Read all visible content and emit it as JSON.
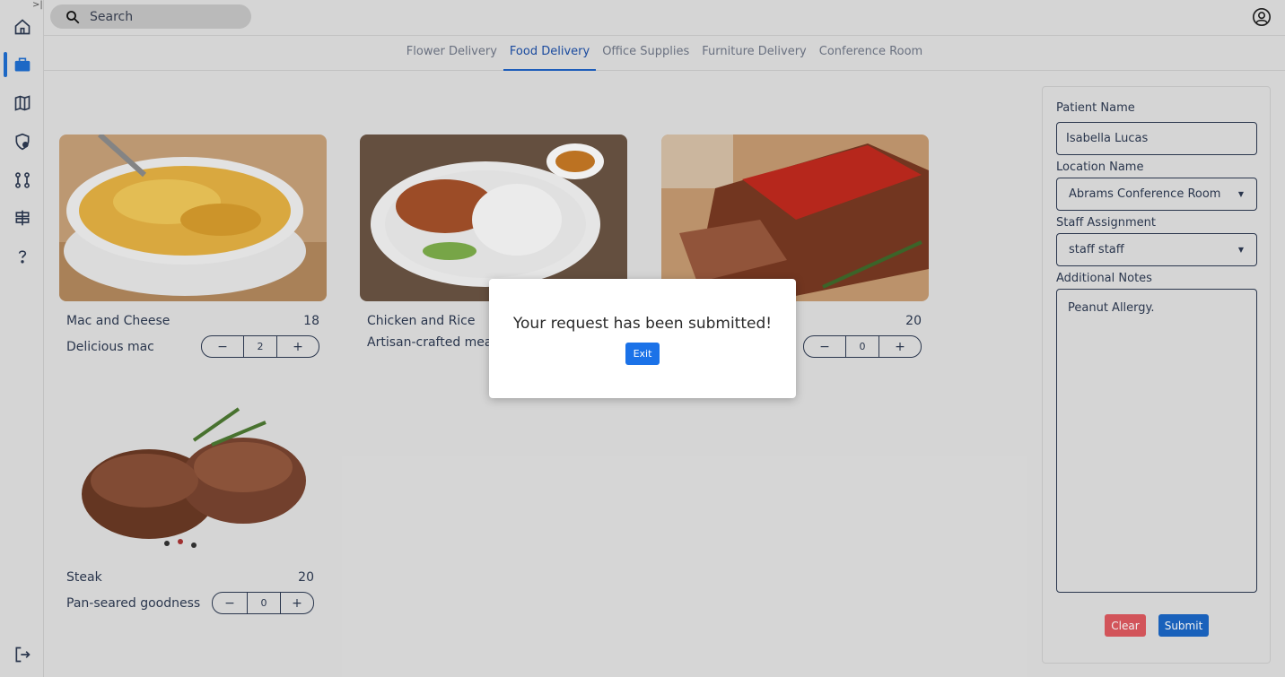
{
  "sidebar": {
    "items": [
      {
        "icon": "home-icon"
      },
      {
        "icon": "briefcase-icon",
        "active": true
      },
      {
        "icon": "map-icon"
      },
      {
        "icon": "shield-clock-icon"
      },
      {
        "icon": "git-compare-icon"
      },
      {
        "icon": "signpost-icon"
      },
      {
        "icon": "help-icon"
      }
    ],
    "logout_icon": "logout-icon",
    "expand_glyph": ">|"
  },
  "search": {
    "placeholder": "Search"
  },
  "tabs": [
    {
      "label": "Flower Delivery"
    },
    {
      "label": "Food Delivery",
      "active": true
    },
    {
      "label": "Office Supplies"
    },
    {
      "label": "Furniture Delivery"
    },
    {
      "label": "Conference Room"
    }
  ],
  "foods": [
    {
      "name": "Mac and Cheese",
      "price": "18",
      "description": "Delicious mac",
      "quantity": "2",
      "minus": "−",
      "plus": "+"
    },
    {
      "name": "Chicken and Rice",
      "price": "",
      "description": "Artisan-crafted meal",
      "quantity": "",
      "minus": "",
      "plus": ""
    },
    {
      "name": "",
      "price": "20",
      "description": "",
      "quantity": "0",
      "minus": "−",
      "plus": "+"
    },
    {
      "name": "Steak",
      "price": "20",
      "description": "Pan-seared goodness",
      "quantity": "0",
      "minus": "−",
      "plus": "+"
    }
  ],
  "form": {
    "patient_label": "Patient Name",
    "patient_value": "Isabella Lucas",
    "location_label": "Location Name",
    "location_value": "Abrams Conference Room",
    "staff_label": "Staff Assignment",
    "staff_value": "staff staff",
    "notes_label": "Additional Notes",
    "notes_value": "Peanut Allergy.",
    "clear_label": "Clear",
    "submit_label": "Submit"
  },
  "modal": {
    "message": "Your request has been submitted!",
    "exit_label": "Exit"
  },
  "colors": {
    "accent": "#1f63c6",
    "clear": "#e05a60",
    "submit": "#1b68c7",
    "text": "#2d3a52"
  }
}
